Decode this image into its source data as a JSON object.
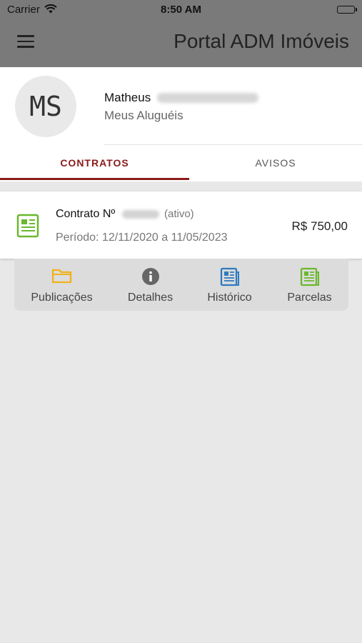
{
  "status_bar": {
    "carrier": "Carrier",
    "time": "8:50 AM"
  },
  "header": {
    "title": "Portal ADM Imóveis",
    "menu_icon": "hamburger-menu-icon"
  },
  "profile": {
    "initials": "MS",
    "first_name": "Matheus",
    "subtitle": "Meus Aluguéis"
  },
  "tabs": [
    {
      "label": "CONTRATOS",
      "active": true
    },
    {
      "label": "AVISOS",
      "active": false
    }
  ],
  "contract": {
    "title": "Contrato Nº",
    "status": "(ativo)",
    "period": "Período: 12/11/2020 a 11/05/2023",
    "value": "R$ 750,00",
    "icon": "document-icon"
  },
  "actions": [
    {
      "label": "Publicações",
      "icon": "folder-icon",
      "color": "#f2b21b"
    },
    {
      "label": "Detalhes",
      "icon": "info-icon",
      "color": "#666666"
    },
    {
      "label": "Histórico",
      "icon": "newspaper-icon",
      "color": "#2e7bbf"
    },
    {
      "label": "Parcelas",
      "icon": "document-icon",
      "color": "#6ab82e"
    }
  ],
  "colors": {
    "accent": "#8b1b1b",
    "header_bg": "#7a7a7a",
    "page_bg": "#e8e8e8"
  }
}
